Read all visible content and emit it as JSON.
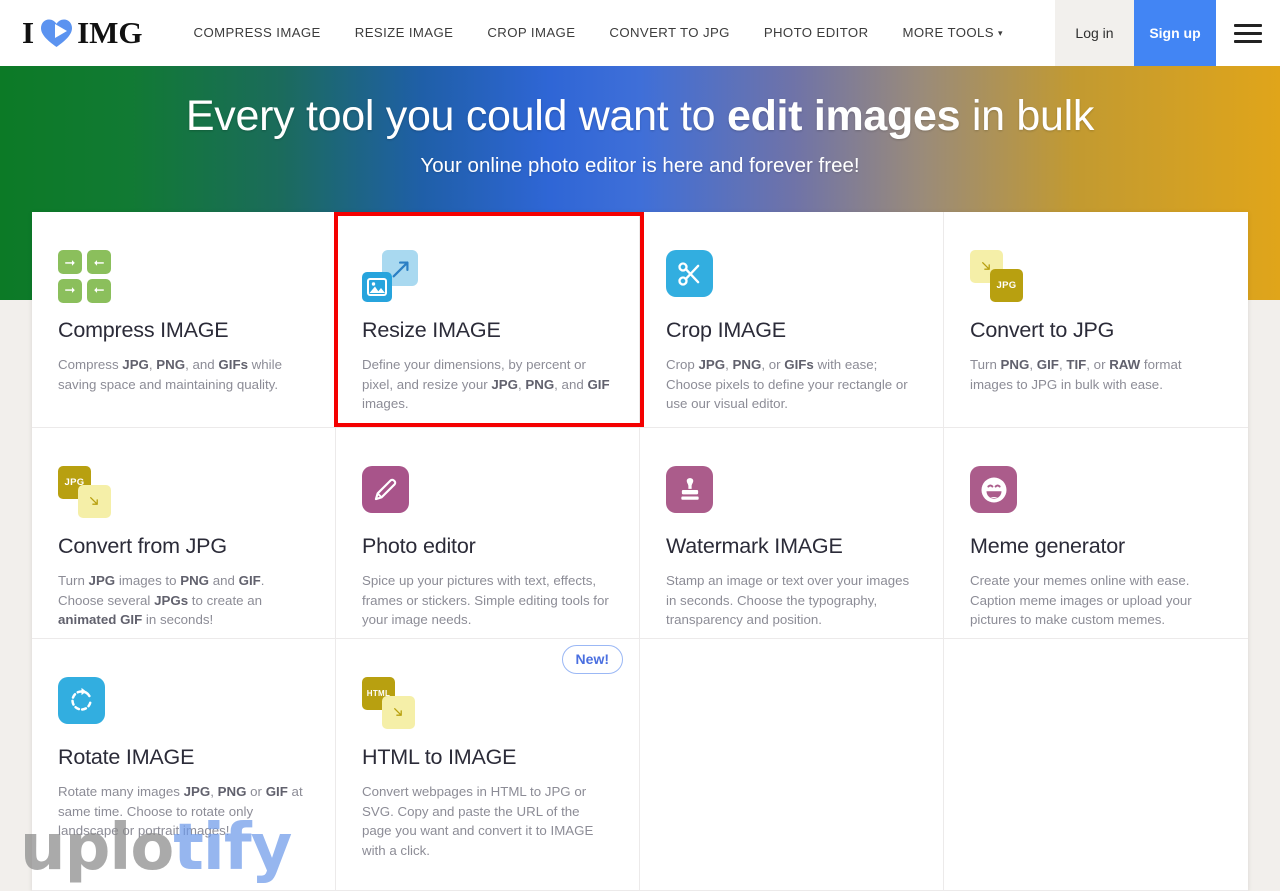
{
  "header": {
    "logo": {
      "prefix": "I",
      "icon": "heart-icon",
      "suffix": "IMG"
    },
    "nav": [
      {
        "label": "COMPRESS IMAGE",
        "name": "nav-compress-image"
      },
      {
        "label": "RESIZE IMAGE",
        "name": "nav-resize-image"
      },
      {
        "label": "CROP IMAGE",
        "name": "nav-crop-image"
      },
      {
        "label": "CONVERT TO JPG",
        "name": "nav-convert-to-jpg"
      },
      {
        "label": "PHOTO EDITOR",
        "name": "nav-photo-editor"
      },
      {
        "label": "MORE TOOLS",
        "name": "nav-more-tools",
        "caret": "▾"
      }
    ],
    "login_label": "Log in",
    "signup_label": "Sign up",
    "menu_icon": "hamburger-menu-icon"
  },
  "hero": {
    "title_plain_1": "Every tool you could want to ",
    "title_bold": "edit images",
    "title_plain_2": " in bulk",
    "subtitle": "Your online photo editor is here and forever free!"
  },
  "tools": [
    {
      "title": "Compress IMAGE",
      "desc_html": "Compress <b>JPG</b>, <b>PNG</b>, and <b>GIFs</b> while saving space and maintaining quality.",
      "icon": "compress-arrows-icon",
      "accent": "#8bbf5c"
    },
    {
      "title": "Resize IMAGE",
      "desc_html": "Define your dimensions, by percent or pixel, and resize your <b>JPG</b>, <b>PNG</b>, and <b>GIF</b> images.",
      "icon": "resize-image-icon",
      "accent": "#27a4dd",
      "highlighted": true
    },
    {
      "title": "Crop IMAGE",
      "desc_html": "Crop <b>JPG</b>, <b>PNG</b>, or <b>GIFs</b> with ease; Choose pixels to define your rectangle or use our visual editor.",
      "icon": "scissors-icon",
      "accent": "#32aee0"
    },
    {
      "title": "Convert to JPG",
      "desc_html": "Turn <b>PNG</b>, <b>GIF</b>, <b>TIF</b>, or <b>RAW</b> format images to JPG in bulk with ease.",
      "icon": "convert-to-jpg-icon",
      "accent": "#b8a010",
      "badge_label": "JPG"
    },
    {
      "title": "Convert from JPG",
      "desc_html": "Turn <b>JPG</b> images to <b>PNG</b> and <b>GIF</b>. Choose several <b>JPGs</b> to create an <b>animated GIF</b> in seconds!",
      "icon": "convert-from-jpg-icon",
      "accent": "#b8a010",
      "badge_label": "JPG"
    },
    {
      "title": "Photo editor",
      "desc_html": "Spice up your pictures with text, effects, frames or stickers. Simple editing tools for your image needs.",
      "icon": "pencil-icon",
      "accent": "#a8548a"
    },
    {
      "title": "Watermark IMAGE",
      "desc_html": "Stamp an image or text over your images in seconds. Choose the typography, transparency and position.",
      "icon": "stamp-icon",
      "accent": "#a8548a"
    },
    {
      "title": "Meme generator",
      "desc_html": "Create your memes online with ease. Caption meme images or upload your pictures to make custom memes.",
      "icon": "smiley-face-icon",
      "accent": "#a8548a"
    },
    {
      "title": "Rotate IMAGE",
      "desc_html": "Rotate many images <b>JPG</b>, <b>PNG</b> or <b>GIF</b> at same time. Choose to rotate only landscape or portrait images!",
      "icon": "rotate-icon",
      "accent": "#32aee0"
    },
    {
      "title": "HTML to IMAGE",
      "desc_html": "Convert webpages in HTML to JPG or SVG. Copy and paste the URL of the page you want and convert it to IMAGE with a click.",
      "icon": "html-to-image-icon",
      "accent": "#b8a010",
      "badge_label": "HTML",
      "new_badge": "New!"
    }
  ],
  "watermark": {
    "part1": "uplo",
    "part2": "tify"
  },
  "colors": {
    "brand_blue": "#4285f4",
    "highlight_red": "#f40000",
    "hero_gradient_start": "#0c7a26",
    "hero_gradient_mid": "#2f66d6",
    "hero_gradient_end": "#e0a51a"
  }
}
